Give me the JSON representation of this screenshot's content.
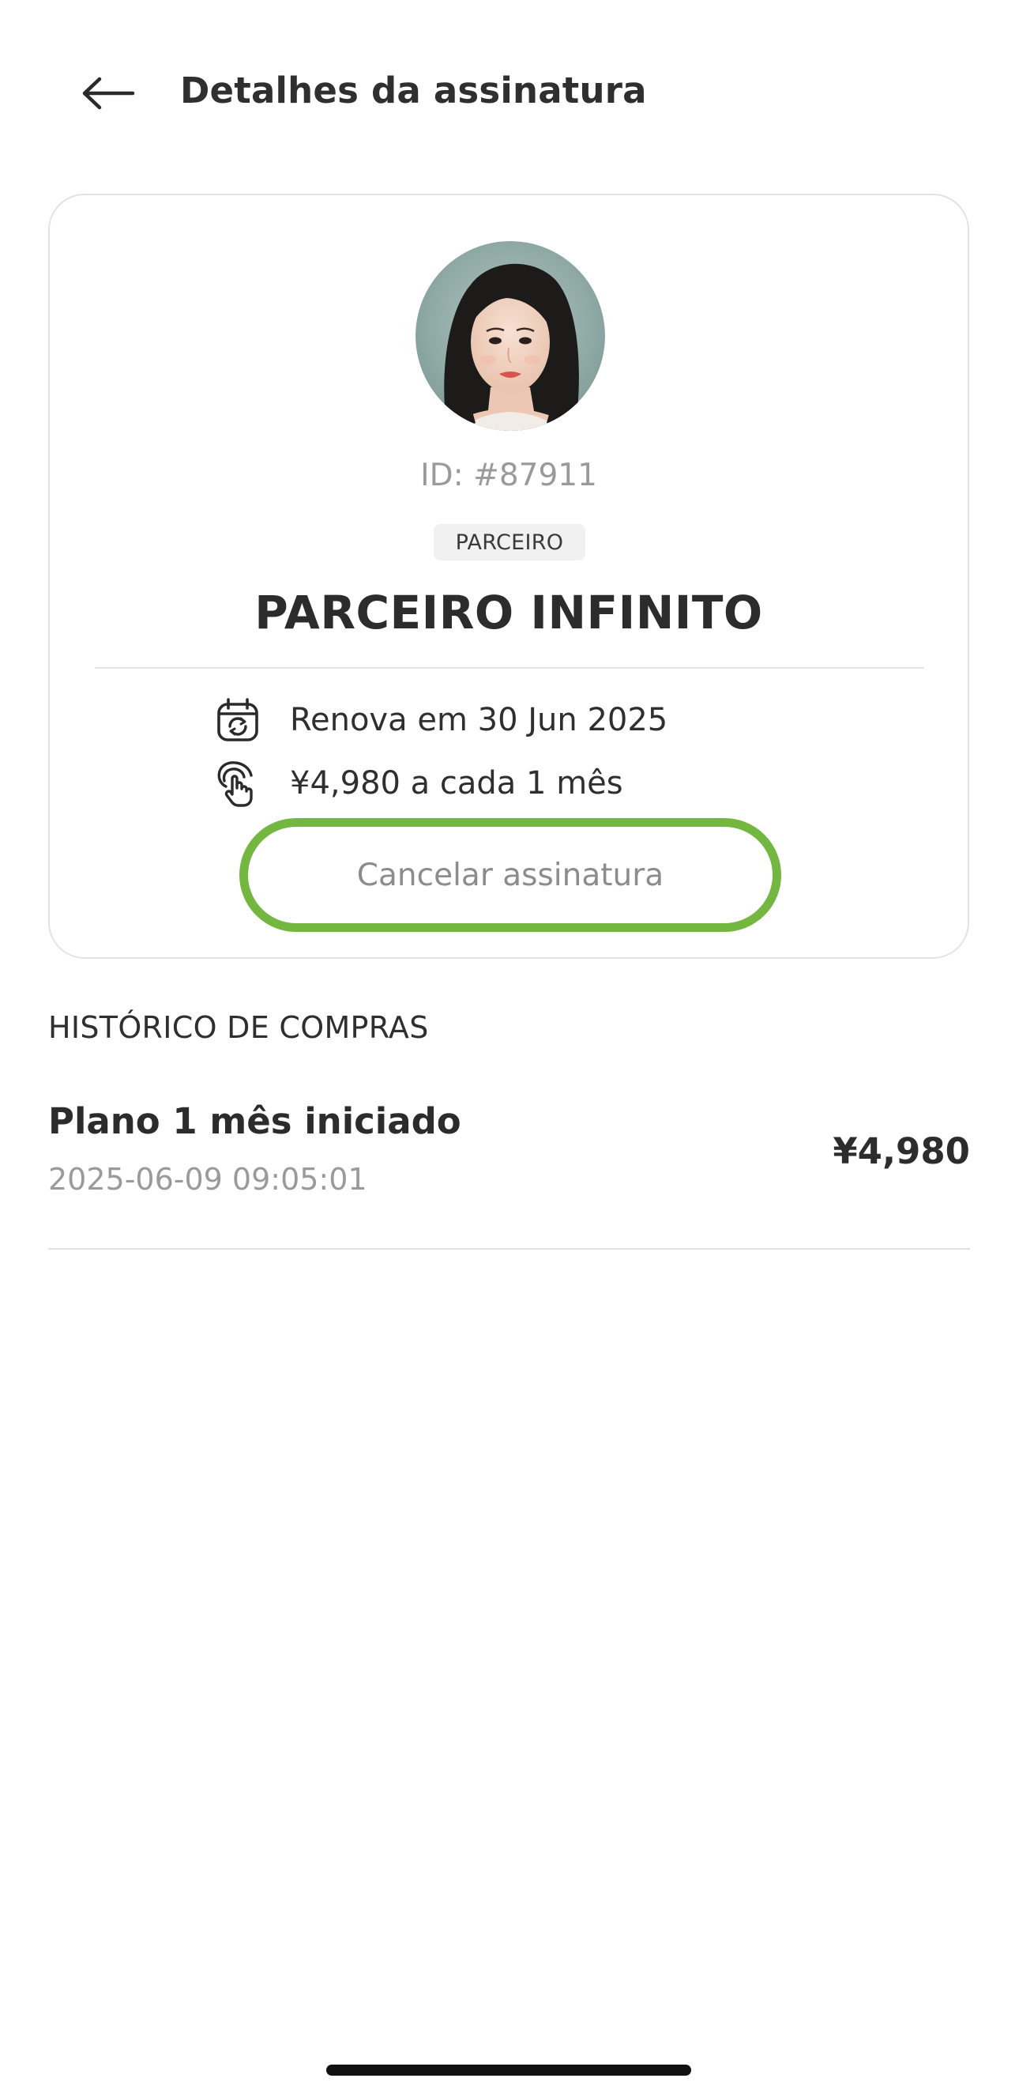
{
  "header": {
    "title": "Detalhes da assinatura",
    "back_icon": "arrow-left-icon"
  },
  "subscription": {
    "id_label": "ID: #87911",
    "tag": "PARCEIRO",
    "plan_name": "PARCEIRO INFINITO",
    "renew_text": "Renova em 30 Jun 2025",
    "renew_icon": "calendar-refresh-icon",
    "price_text": "¥4,980 a cada 1 mês",
    "price_icon": "tap-hand-icon",
    "cancel_label": "Cancelar assinatura",
    "cancel_highlight_color": "#73b640"
  },
  "history": {
    "title": "HISTÓRICO DE COMPRAS",
    "items": [
      {
        "name": "Plano 1 mês iniciado",
        "date": "2025-06-09 09:05:01",
        "amount": "¥4,980"
      }
    ]
  }
}
